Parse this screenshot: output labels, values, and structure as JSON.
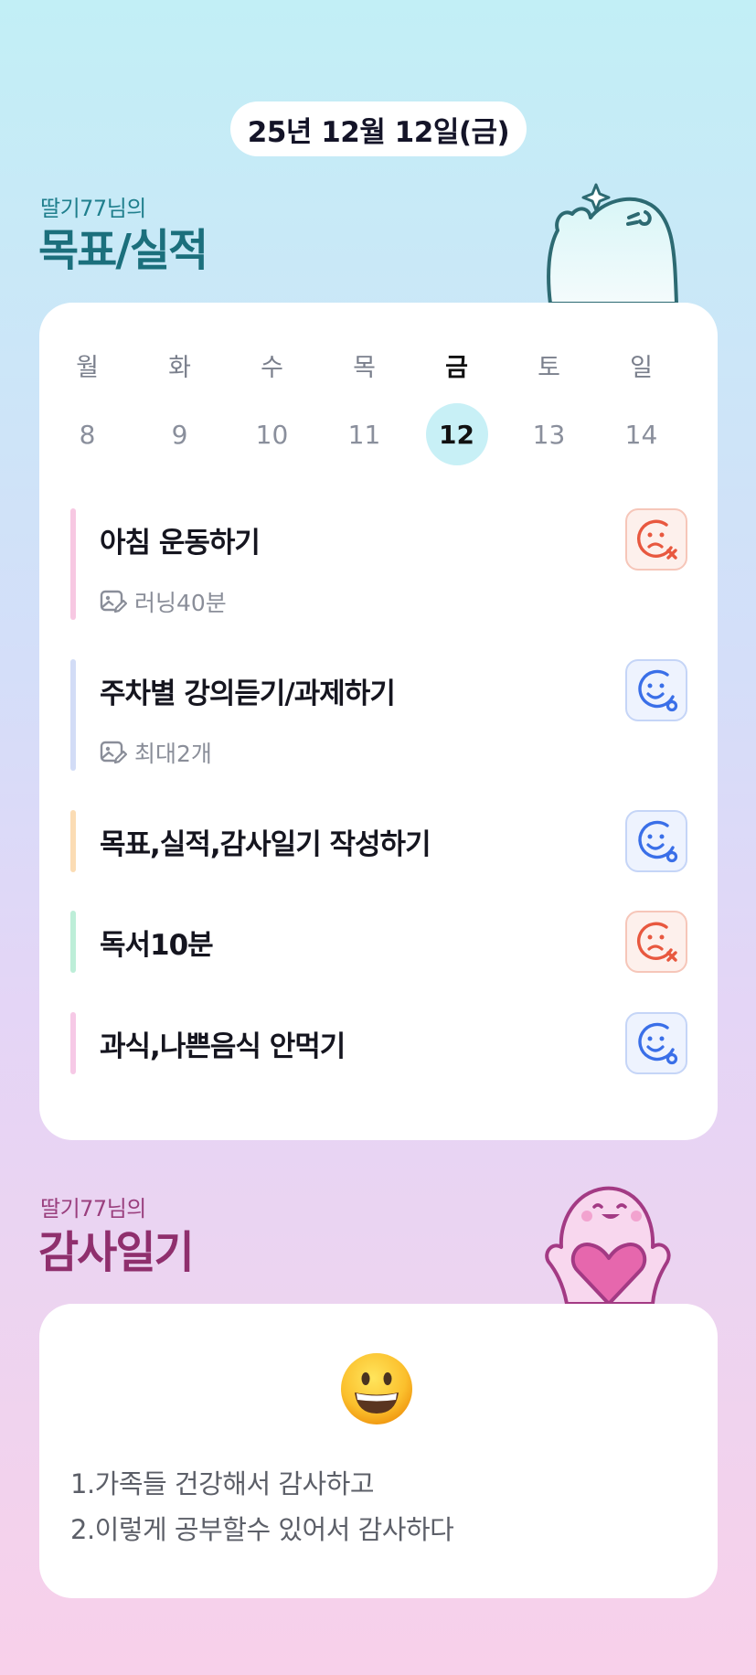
{
  "date_label": "25년 12월 12일(금)",
  "goals": {
    "owner_label": "딸기77님의",
    "title": "목표/실적"
  },
  "week": {
    "days": [
      "월",
      "화",
      "수",
      "목",
      "금",
      "토",
      "일"
    ],
    "dates": [
      "8",
      "9",
      "10",
      "11",
      "12",
      "13",
      "14"
    ],
    "selected_index": 4,
    "selected_color": "#c8f0f6"
  },
  "tasks": [
    {
      "title": "아침 운동하기",
      "note": "러닝40분",
      "status": "fail",
      "bar_color": "#f7c8e2"
    },
    {
      "title": "주차별 강의듣기/과제하기",
      "note": "최대2개",
      "status": "ok",
      "bar_color": "#d2dcf6"
    },
    {
      "title": "목표,실적,감사일기 작성하기",
      "note": "",
      "status": "ok",
      "bar_color": "#fbdcb4"
    },
    {
      "title": "독서10분",
      "note": "",
      "status": "fail",
      "bar_color": "#bdeed8"
    },
    {
      "title": "과식,나쁜음식 안먹기",
      "note": "",
      "status": "ok",
      "bar_color": "#f6c9e6"
    }
  ],
  "status_colors": {
    "fail": "#e8583f",
    "ok": "#3a6fe8"
  },
  "thanks": {
    "owner_label": "딸기77님의",
    "title": "감사일기",
    "mood_icon": "grinning-face",
    "lines": [
      "1.가족들 건강해서 감사하고",
      "2.이렇게 공부할수 있어서 감사하다"
    ]
  }
}
